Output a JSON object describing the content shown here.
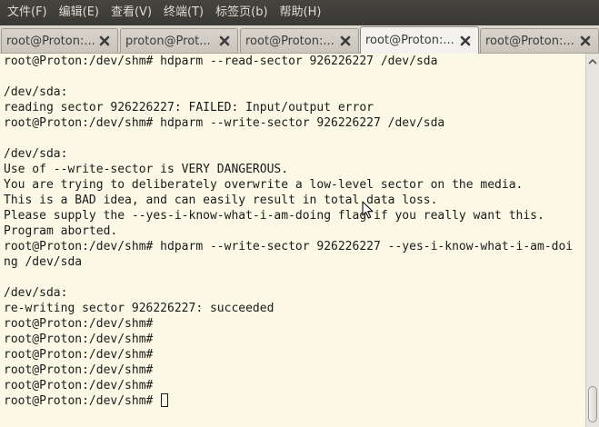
{
  "menu": {
    "items": [
      {
        "label": "文件(F)"
      },
      {
        "label": "编辑(E)"
      },
      {
        "label": "查看(V)"
      },
      {
        "label": "终端(T)"
      },
      {
        "label": "标签页(b)"
      },
      {
        "label": "帮助(H)"
      }
    ]
  },
  "tabs": [
    {
      "label": "root@Proton:...",
      "active": false
    },
    {
      "label": "proton@Prot...",
      "active": false
    },
    {
      "label": "root@Proton:...",
      "active": false
    },
    {
      "label": "root@Proton:...",
      "active": true
    },
    {
      "label": "root@Proton:...",
      "active": false
    }
  ],
  "terminal": {
    "lines": [
      "root@Proton:/dev/shm# hdparm --read-sector 926226227 /dev/sda",
      "",
      "/dev/sda:",
      "reading sector 926226227: FAILED: Input/output error",
      "root@Proton:/dev/shm# hdparm --write-sector 926226227 /dev/sda",
      "",
      "/dev/sda:",
      "Use of --write-sector is VERY DANGEROUS.",
      "You are trying to deliberately overwrite a low-level sector on the media.",
      "This is a BAD idea, and can easily result in total data loss.",
      "Please supply the --yes-i-know-what-i-am-doing flag if you really want this.",
      "Program aborted.",
      "root@Proton:/dev/shm# hdparm --write-sector 926226227 --yes-i-know-what-i-am-doi",
      "ng /dev/sda",
      "",
      "/dev/sda:",
      "re-writing sector 926226227: succeeded",
      "root@Proton:/dev/shm#",
      "root@Proton:/dev/shm#",
      "root@Proton:/dev/shm#",
      "root@Proton:/dev/shm#",
      "root@Proton:/dev/shm#",
      "root@Proton:/dev/shm# "
    ]
  },
  "icons": {
    "tab_close": "close-icon",
    "mouse": "mouse-pointer-icon",
    "scroll_up": "chevron-up-icon"
  },
  "colors": {
    "menubar_bg": "#3c3b37",
    "terminal_bg": "#fbf9e6",
    "terminal_fg": "#1a1a1a"
  }
}
